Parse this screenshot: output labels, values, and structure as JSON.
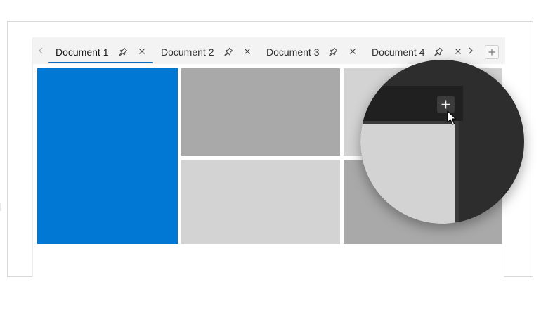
{
  "tabs": [
    {
      "label": "Document 1",
      "active": true
    },
    {
      "label": "Document 2",
      "active": false
    },
    {
      "label": "Document 3",
      "active": false
    },
    {
      "label": "Document 4",
      "active": false
    }
  ],
  "icons": {
    "pin": "pin-icon",
    "close": "close-icon",
    "add": "plus-icon",
    "scroll_left": "chevron-left-icon",
    "scroll_right": "chevron-right-icon",
    "cursor": "mouse-pointer-icon"
  },
  "colors": {
    "accent": "#0f6cbd",
    "panel_blue": "#0078d4",
    "panel_gray_dark": "#a9a9a9",
    "panel_gray_light": "#d3d3d3",
    "magnifier_bg": "#2d2d2d"
  }
}
